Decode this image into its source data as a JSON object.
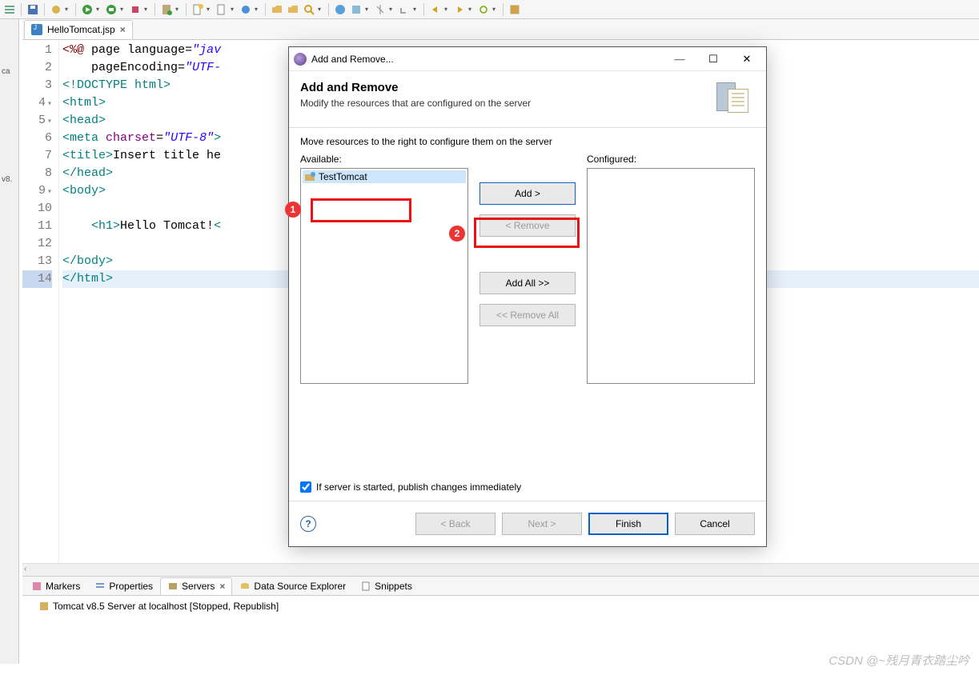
{
  "leftStub": {
    "label1": "ca",
    "label2": "v8."
  },
  "editor": {
    "tab": {
      "filename": "HelloTomcat.jsp"
    },
    "lines": [
      {
        "n": "1",
        "fold": "",
        "html": "<span class='jspdir'>&lt;%@</span> <span class='jspattr'>page</span> <span class='jspattr'>language</span>=<span class='val'>\"jav</span>"
      },
      {
        "n": "2",
        "fold": "",
        "html": "    <span class='jspattr'>pageEncoding</span>=<span class='val'>\"UTF-</span>"
      },
      {
        "n": "3",
        "fold": "",
        "html": "<span class='tag'>&lt;!DOCTYPE</span> <span class='tag'>html&gt;</span>"
      },
      {
        "n": "4",
        "fold": "▾",
        "html": "<span class='tag'>&lt;html&gt;</span>"
      },
      {
        "n": "5",
        "fold": "▾",
        "html": "<span class='tag'>&lt;head&gt;</span>"
      },
      {
        "n": "6",
        "fold": "",
        "html": "<span class='tag'>&lt;meta</span> <span class='attr'>charset</span>=<span class='val'>\"UTF-8\"</span><span class='tag'>&gt;</span>"
      },
      {
        "n": "7",
        "fold": "",
        "html": "<span class='tag'>&lt;title&gt;</span><span class='text-c'>Insert title he</span>"
      },
      {
        "n": "8",
        "fold": "",
        "html": "<span class='tag'>&lt;/head&gt;</span>"
      },
      {
        "n": "9",
        "fold": "▾",
        "html": "<span class='tag'>&lt;body&gt;</span>"
      },
      {
        "n": "10",
        "fold": "",
        "html": ""
      },
      {
        "n": "11",
        "fold": "",
        "html": "    <span class='tag'>&lt;h1&gt;</span><span class='text-c'>Hello Tomcat!</span><span class='tag'>&lt;</span>"
      },
      {
        "n": "12",
        "fold": "",
        "html": ""
      },
      {
        "n": "13",
        "fold": "",
        "html": "<span class='tag'>&lt;/body&gt;</span>"
      },
      {
        "n": "14",
        "fold": "",
        "html": "<span class='tag'>&lt;/html&gt;</span>",
        "selected": true
      }
    ]
  },
  "bottom": {
    "tabs": {
      "markers": "Markers",
      "properties": "Properties",
      "servers": "Servers",
      "dse": "Data Source Explorer",
      "snippets": "Snippets"
    },
    "serverRow": "Tomcat v8.5 Server at localhost  [Stopped, Republish]"
  },
  "dialog": {
    "titlebar": "Add and Remove...",
    "heading": "Add and Remove",
    "subheading": "Modify the resources that are configured on the server",
    "prompt": "Move resources to the right to configure them on the server",
    "availableLabel": "Available:",
    "configuredLabel": "Configured:",
    "availableItems": [
      "TestTomcat"
    ],
    "buttons": {
      "add": "Add >",
      "remove": "< Remove",
      "addAll": "Add All >>",
      "removeAll": "<< Remove All"
    },
    "checkboxLabel": "If server is started, publish changes immediately",
    "footer": {
      "back": "< Back",
      "next": "Next >",
      "finish": "Finish",
      "cancel": "Cancel"
    }
  },
  "callouts": {
    "c1": "1",
    "c2": "2"
  },
  "watermark": "CSDN @~残月青衣踏尘吟"
}
